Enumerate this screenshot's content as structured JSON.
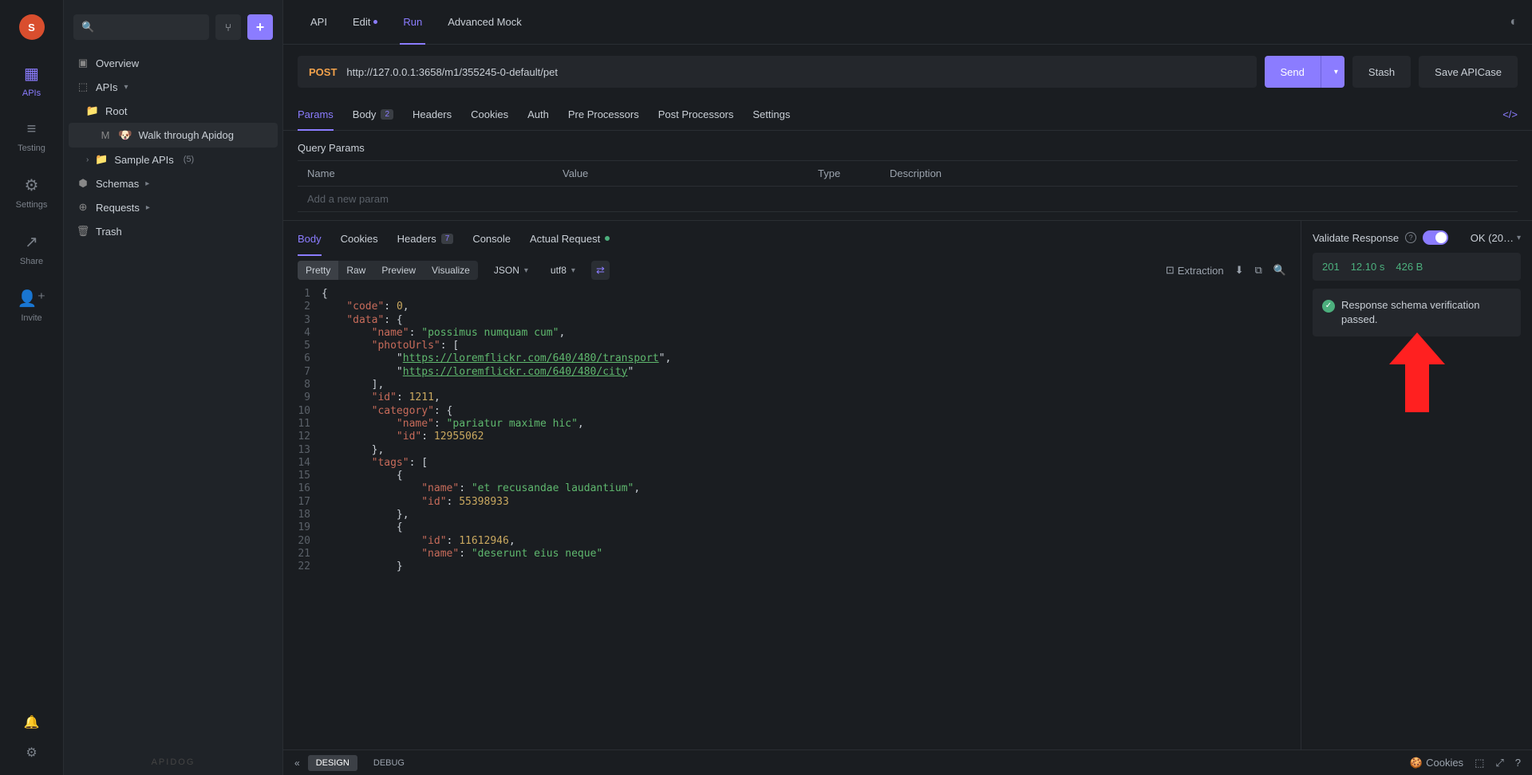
{
  "avatar_letter": "S",
  "rail": {
    "apis": "APIs",
    "testing": "Testing",
    "settings": "Settings",
    "share": "Share",
    "invite": "Invite"
  },
  "sidebar": {
    "overview": "Overview",
    "apis": "APIs",
    "root": "Root",
    "walk": "Walk through Apidog",
    "sample": "Sample APIs",
    "sample_count": "(5)",
    "schemas": "Schemas",
    "requests": "Requests",
    "trash": "Trash",
    "footer": "APIDOG"
  },
  "top_tabs": {
    "api": "API",
    "edit": "Edit",
    "run": "Run",
    "mock": "Advanced Mock"
  },
  "request": {
    "method": "POST",
    "url_base": "http://127.0.0.1:3658/m1/355245-0-default",
    "url_path": "/pet",
    "send": "Send",
    "stash": "Stash",
    "save": "Save APICase"
  },
  "sub_tabs": {
    "params": "Params",
    "body": "Body",
    "body_badge": "2",
    "headers": "Headers",
    "cookies": "Cookies",
    "auth": "Auth",
    "pre": "Pre Processors",
    "post": "Post Processors",
    "settings": "Settings"
  },
  "query": {
    "title": "Query Params",
    "name": "Name",
    "value": "Value",
    "type": "Type",
    "desc": "Description",
    "add": "Add a new param"
  },
  "resp_tabs": {
    "body": "Body",
    "cookies": "Cookies",
    "headers": "Headers",
    "headers_badge": "7",
    "console": "Console",
    "actual": "Actual Request"
  },
  "view": {
    "pretty": "Pretty",
    "raw": "Raw",
    "preview": "Preview",
    "visualize": "Visualize",
    "json": "JSON",
    "utf8": "utf8",
    "extraction": "Extraction"
  },
  "validate": {
    "label": "Validate Response",
    "status": "OK (20…",
    "code": "201",
    "time": "12.10 s",
    "size": "426 B",
    "msg": "Response schema verification passed."
  },
  "bottom": {
    "design": "DESIGN",
    "debug": "DEBUG",
    "cookies": "Cookies"
  },
  "code_lines": [
    {
      "n": 1,
      "html": "<span class='j-punc'>{</span>"
    },
    {
      "n": 2,
      "html": "    <span class='j-key'>\"code\"</span><span class='j-punc'>: </span><span class='j-num'>0</span><span class='j-punc'>,</span>"
    },
    {
      "n": 3,
      "html": "    <span class='j-key'>\"data\"</span><span class='j-punc'>: {</span>"
    },
    {
      "n": 4,
      "html": "        <span class='j-key'>\"name\"</span><span class='j-punc'>: </span><span class='j-str'>\"possimus numquam cum\"</span><span class='j-punc'>,</span>"
    },
    {
      "n": 5,
      "html": "        <span class='j-key'>\"photoUrls\"</span><span class='j-punc'>: [</span>"
    },
    {
      "n": 6,
      "html": "            <span class='j-punc'>\"</span><span class='j-link'>https://loremflickr.com/640/480/transport</span><span class='j-punc'>\",</span>"
    },
    {
      "n": 7,
      "html": "            <span class='j-punc'>\"</span><span class='j-link'>https://loremflickr.com/640/480/city</span><span class='j-punc'>\"</span>"
    },
    {
      "n": 8,
      "html": "        <span class='j-punc'>],</span>"
    },
    {
      "n": 9,
      "html": "        <span class='j-key'>\"id\"</span><span class='j-punc'>: </span><span class='j-num'>1211</span><span class='j-punc'>,</span>"
    },
    {
      "n": 10,
      "html": "        <span class='j-key'>\"category\"</span><span class='j-punc'>: {</span>"
    },
    {
      "n": 11,
      "html": "            <span class='j-key'>\"name\"</span><span class='j-punc'>: </span><span class='j-str'>\"pariatur maxime hic\"</span><span class='j-punc'>,</span>"
    },
    {
      "n": 12,
      "html": "            <span class='j-key'>\"id\"</span><span class='j-punc'>: </span><span class='j-num'>12955062</span>"
    },
    {
      "n": 13,
      "html": "        <span class='j-punc'>},</span>"
    },
    {
      "n": 14,
      "html": "        <span class='j-key'>\"tags\"</span><span class='j-punc'>: [</span>"
    },
    {
      "n": 15,
      "html": "            <span class='j-punc'>{</span>"
    },
    {
      "n": 16,
      "html": "                <span class='j-key'>\"name\"</span><span class='j-punc'>: </span><span class='j-str'>\"et recusandae laudantium\"</span><span class='j-punc'>,</span>"
    },
    {
      "n": 17,
      "html": "                <span class='j-key'>\"id\"</span><span class='j-punc'>: </span><span class='j-num'>55398933</span>"
    },
    {
      "n": 18,
      "html": "            <span class='j-punc'>},</span>"
    },
    {
      "n": 19,
      "html": "            <span class='j-punc'>{</span>"
    },
    {
      "n": 20,
      "html": "                <span class='j-key'>\"id\"</span><span class='j-punc'>: </span><span class='j-num'>11612946</span><span class='j-punc'>,</span>"
    },
    {
      "n": 21,
      "html": "                <span class='j-key'>\"name\"</span><span class='j-punc'>: </span><span class='j-str'>\"deserunt eius neque\"</span>"
    },
    {
      "n": 22,
      "html": "            <span class='j-punc'>}</span>"
    }
  ]
}
